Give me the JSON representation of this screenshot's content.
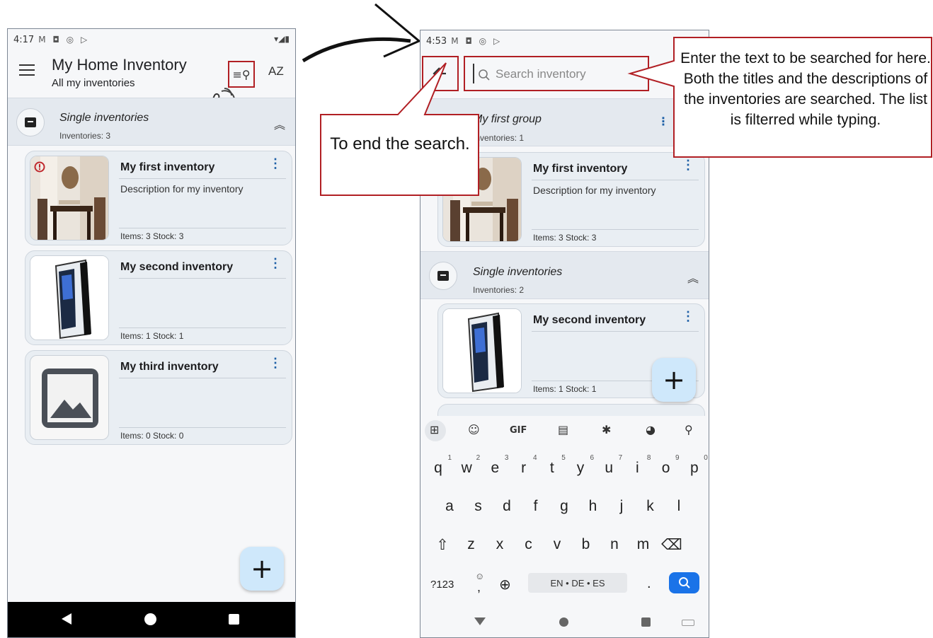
{
  "left_phone": {
    "status_time": "4:17",
    "status_icons": "M ◘ ◎ ▷",
    "status_right": "▾◢▮",
    "title": "My Home Inventory",
    "subtitle": "All my inventories",
    "az_label": "AZ",
    "group": {
      "title": "Single inventories",
      "count": "Inventories: 3"
    },
    "cards": [
      {
        "title": "My first inventory",
        "desc": "Description for my inventory",
        "meta": "Items: 3   Stock: 3"
      },
      {
        "title": "My second inventory",
        "desc": "",
        "meta": "Items: 1   Stock: 1"
      },
      {
        "title": "My third inventory",
        "desc": "",
        "meta": "Items: 0   Stock: 0"
      }
    ],
    "fab_label": "+"
  },
  "right_phone": {
    "status_time": "4:53",
    "status_icons": "M ◘ ◎ ▷",
    "search_placeholder": "Search inventory",
    "group1": {
      "title": "My first group",
      "count": "Inventories: 1"
    },
    "card1": {
      "title": "My first inventory",
      "desc": "Description for my inventory",
      "meta": "Items: 3   Stock: 3"
    },
    "group2": {
      "title": "Single inventories",
      "count": "Inventories: 2"
    },
    "card2": {
      "title": "My second inventory",
      "meta": "Items: 1   Stock: 1"
    },
    "fab_label": "+",
    "keyboard": {
      "toolbar": [
        "⊞",
        "☺",
        "GIF",
        "▤",
        "✱",
        "◕",
        "⚲"
      ],
      "row1": [
        {
          "k": "q",
          "n": "1"
        },
        {
          "k": "w",
          "n": "2"
        },
        {
          "k": "e",
          "n": "3"
        },
        {
          "k": "r",
          "n": "4"
        },
        {
          "k": "t",
          "n": "5"
        },
        {
          "k": "y",
          "n": "6"
        },
        {
          "k": "u",
          "n": "7"
        },
        {
          "k": "i",
          "n": "8"
        },
        {
          "k": "o",
          "n": "9"
        },
        {
          "k": "p",
          "n": "0"
        }
      ],
      "row2": [
        "a",
        "s",
        "d",
        "f",
        "g",
        "h",
        "j",
        "k",
        "l"
      ],
      "row3": [
        "⇧",
        "z",
        "x",
        "c",
        "v",
        "b",
        "n",
        "m",
        "⌫"
      ],
      "symbols_key": "?123",
      "emoji_key": "☺",
      "emoji_sub": ",",
      "globe_key": "⊕",
      "space_label": "EN • DE • ES",
      "period_key": ".",
      "search_key": "⚲"
    }
  },
  "callouts": {
    "end_search": "To end the search.",
    "search_help": "Enter the text to be searched for here. Both the titles and the descriptions of the inventories are searched. The list is filterred while typing."
  },
  "colors": {
    "highlight": "#b11f24",
    "fab": "#cfe8fb",
    "band": "#e4e9ef",
    "card": "#e9eef3",
    "accent": "#1d5fa6"
  }
}
